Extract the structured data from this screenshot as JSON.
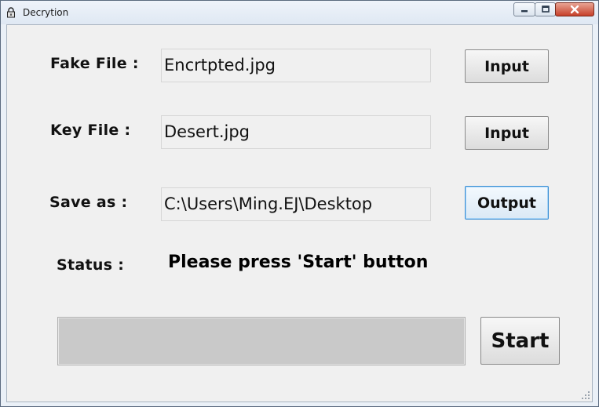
{
  "window": {
    "title": "Decrytion",
    "controls": {
      "minimize_icon": "minimize-icon",
      "maximize_icon": "maximize-icon",
      "close_icon": "close-icon"
    }
  },
  "form": {
    "fake_file": {
      "label": "Fake File :",
      "value": "Encrtpted.jpg",
      "button": "Input"
    },
    "key_file": {
      "label": "Key File :",
      "value": "Desert.jpg",
      "button": "Input"
    },
    "save_as": {
      "label": "Save as :",
      "value": "C:\\Users\\Ming.EJ\\Desktop",
      "button": "Output"
    }
  },
  "status": {
    "label": "Status :",
    "message": "Please press 'Start' button"
  },
  "progress": {
    "value": 0
  },
  "start_button": "Start",
  "colors": {
    "client_bg": "#f0f0f0",
    "focus_border": "#3c8fd4",
    "close_red": "#c7402a",
    "progress_track": "#c9c9c9"
  }
}
